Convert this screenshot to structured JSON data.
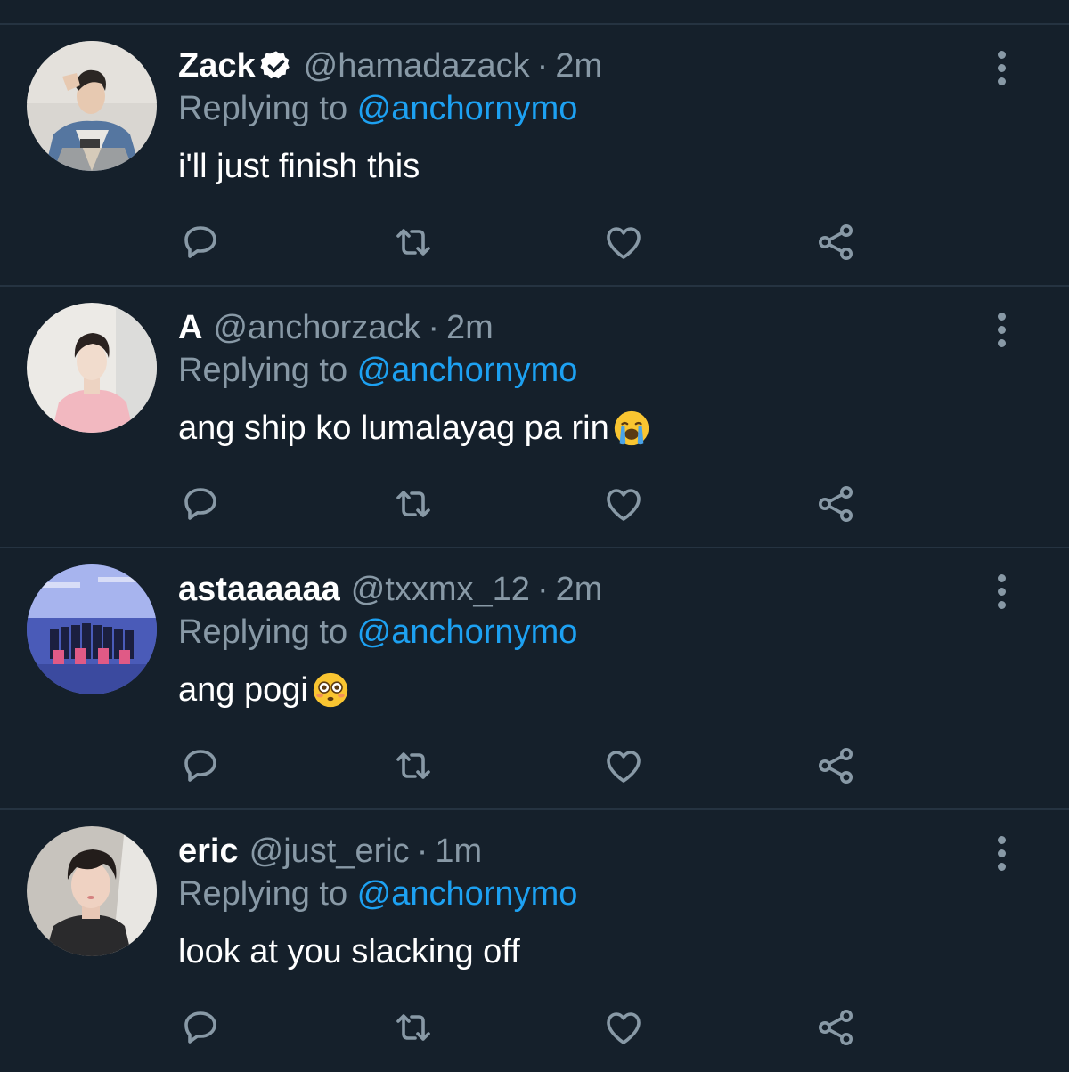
{
  "colors": {
    "background": "#15202b",
    "divider": "#253341",
    "secondary_text": "#8899a6",
    "link": "#1da1f2",
    "primary_text": "#ffffff"
  },
  "tweets": [
    {
      "name": "Zack",
      "verified": true,
      "handle": "@hamadazack",
      "separator": "·",
      "time": "2m",
      "replying_prefix": "Replying to",
      "replying_to": "@anchornymo",
      "text": "i'll just finish this",
      "emoji": null
    },
    {
      "name": "A",
      "verified": false,
      "handle": "@anchorzack",
      "separator": "·",
      "time": "2m",
      "replying_prefix": "Replying to",
      "replying_to": "@anchornymo",
      "text": "ang ship ko lumalayag pa rin",
      "emoji": "loudly-crying-face"
    },
    {
      "name": "astaaaaaa",
      "verified": false,
      "handle": "@txxmx_12",
      "separator": "·",
      "time": "2m",
      "replying_prefix": "Replying to",
      "replying_to": "@anchornymo",
      "text": "ang pogi",
      "emoji": "flushed-face"
    },
    {
      "name": "eric",
      "verified": false,
      "handle": "@just_eric",
      "separator": "·",
      "time": "1m",
      "replying_prefix": "Replying to",
      "replying_to": "@anchornymo",
      "text": "look at you slacking off",
      "emoji": null
    }
  ],
  "icons": {
    "avatar": "profile-photo",
    "verified": "verified-badge-icon",
    "more": "more-vertical-icon",
    "reply": "reply-bubble-icon",
    "retweet": "retweet-icon",
    "like": "heart-icon",
    "share": "share-icon"
  }
}
